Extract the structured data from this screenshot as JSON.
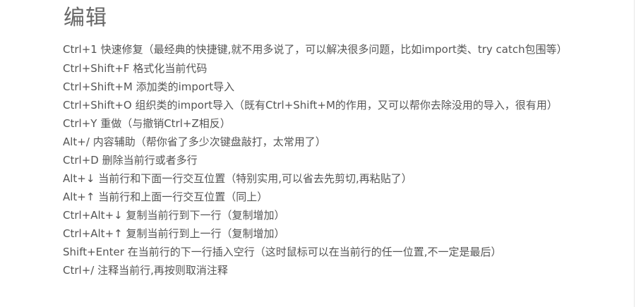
{
  "document": {
    "title": "编辑",
    "lines": [
      "Ctrl+1 快速修复（最经典的快捷键,就不用多说了，可以解决很多问题，比如import类、try catch包围等）",
      "Ctrl+Shift+F 格式化当前代码",
      "Ctrl+Shift+M 添加类的import导入",
      "Ctrl+Shift+O 组织类的import导入（既有Ctrl+Shift+M的作用，又可以帮你去除没用的导入，很有用）",
      "Ctrl+Y 重做（与撤销Ctrl+Z相反）",
      "Alt+/ 内容辅助（帮你省了多少次键盘敲打，太常用了）",
      "Ctrl+D 删除当前行或者多行",
      "Alt+↓ 当前行和下面一行交互位置（特别实用,可以省去先剪切,再粘贴了）",
      "Alt+↑ 当前行和上面一行交互位置（同上）",
      "Ctrl+Alt+↓ 复制当前行到下一行（复制增加）",
      "Ctrl+Alt+↑ 复制当前行到上一行（复制增加）",
      "Shift+Enter 在当前行的下一行插入空行（这时鼠标可以在当前行的任一位置,不一定是最后）",
      "Ctrl+/ 注释当前行,再按则取消注释"
    ]
  },
  "colors": {
    "background": "#ffffff",
    "title": "#666666",
    "text": "#555555"
  }
}
